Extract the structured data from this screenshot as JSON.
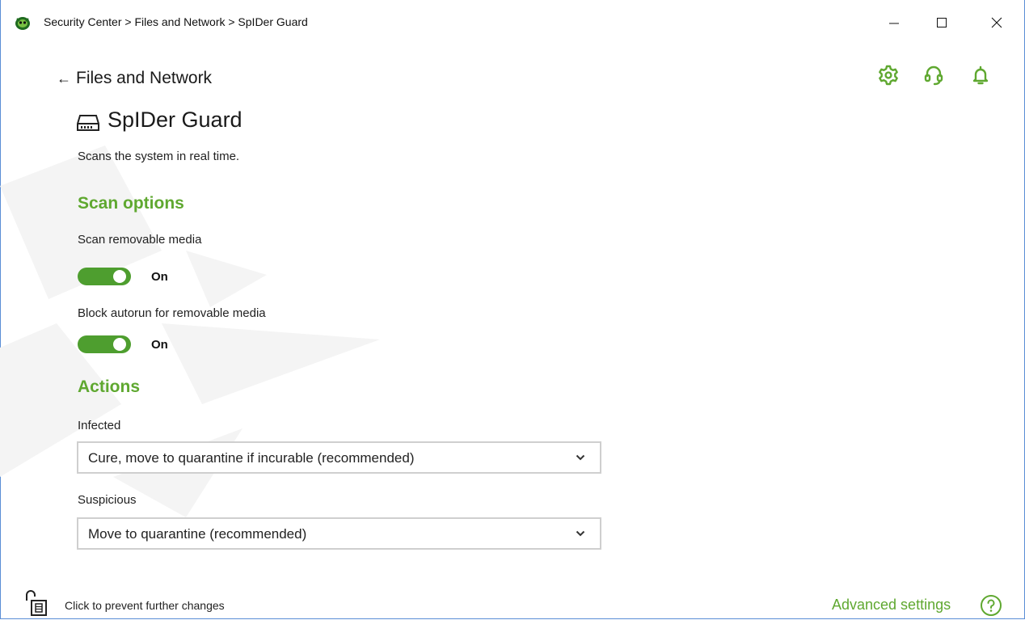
{
  "window": {
    "title": "Security Center > Files and Network > SpIDer Guard",
    "controls": [
      "minimize-icon",
      "maximize-icon",
      "close-icon"
    ]
  },
  "toolbar": {
    "icons": [
      "gear-icon",
      "headset-icon",
      "bell-icon"
    ],
    "accent_color": "#5fa830"
  },
  "nav": {
    "back_label": "Files and Network"
  },
  "header": {
    "title": "SpIDer Guard",
    "description": "Scans the system in real time."
  },
  "scan_options": {
    "title": "Scan options",
    "items": [
      {
        "label": "Scan removable media",
        "state": "On",
        "enabled": true
      },
      {
        "label": "Block autorun for removable media",
        "state": "On",
        "enabled": true
      }
    ]
  },
  "actions": {
    "title": "Actions",
    "items": [
      {
        "label": "Infected",
        "selected": "Cure, move to quarantine if incurable (recommended)"
      },
      {
        "label": "Suspicious",
        "selected": "Move to quarantine (recommended)"
      }
    ]
  },
  "footer": {
    "lock_text": "Click to prevent further changes",
    "advanced_label": "Advanced settings",
    "help_icon": "help-icon"
  },
  "colors": {
    "accent": "#5fa830",
    "toggle_on": "#4e9e2f",
    "window_border": "#5a8ed6"
  }
}
